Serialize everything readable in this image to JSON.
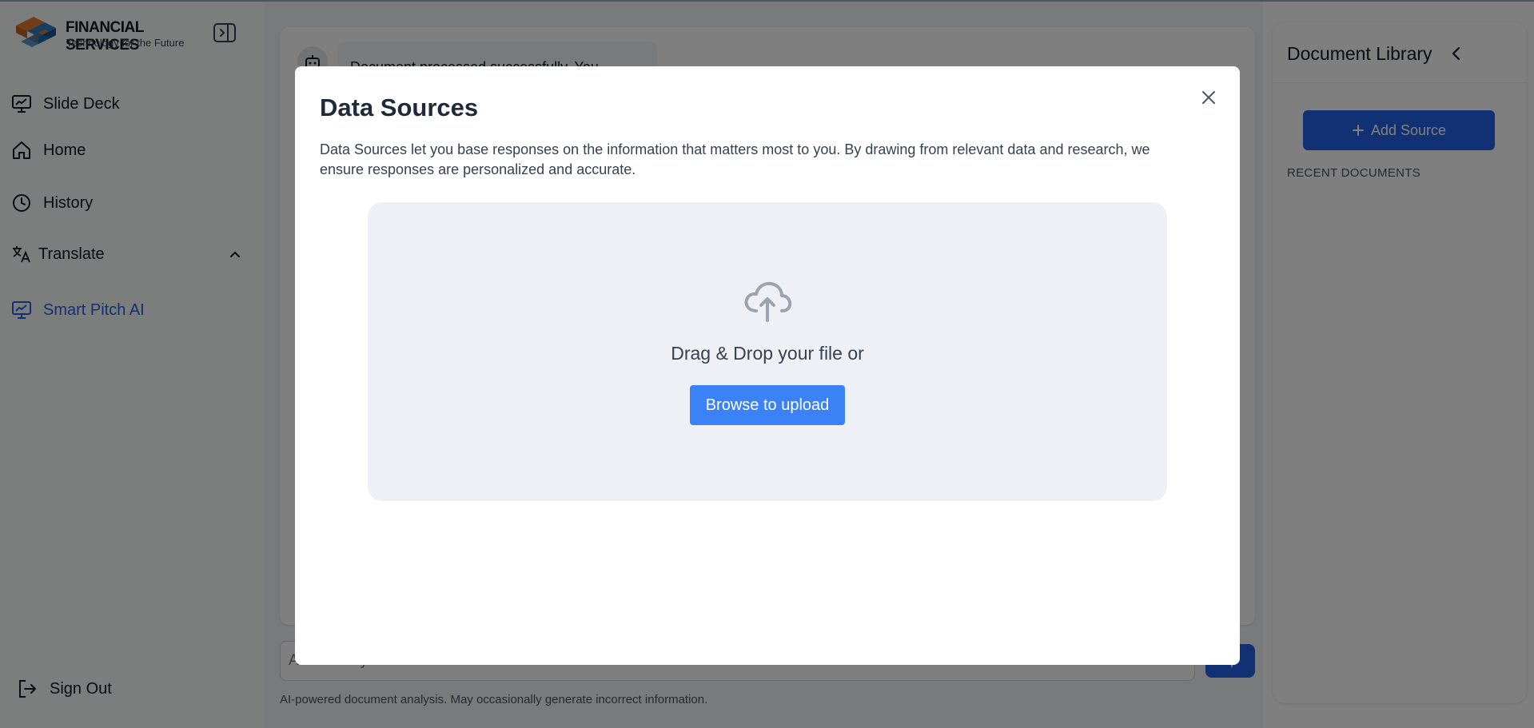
{
  "brand": {
    "title": "FINANCIAL SERVICES",
    "tagline": "Technology for the Future",
    "colors": {
      "orange": "#e07a2e",
      "blue": "#1e6fb8"
    }
  },
  "sidebar": {
    "collapse_icon": "sidebar-toggle-icon",
    "items": [
      {
        "label": "Slide Deck",
        "icon": "presentation-icon"
      },
      {
        "label": "Home",
        "icon": "home-icon"
      },
      {
        "label": "History",
        "icon": "clock-icon"
      },
      {
        "label": "Translate",
        "icon": "translate-icon",
        "expanded": true
      },
      {
        "label": "Smart Pitch AI",
        "icon": "presentation-icon",
        "active": true
      }
    ],
    "signout_label": "Sign Out"
  },
  "chat": {
    "bot_message": "Document processed successfully. You",
    "input_placeholder": "Ask about your document...",
    "disclaimer": "AI-powered document analysis. May occasionally generate incorrect information."
  },
  "library": {
    "title": "Document Library",
    "add_source_label": "Add Source",
    "recent_label": "RECENT DOCUMENTS"
  },
  "modal": {
    "title": "Data Sources",
    "description": "Data Sources let you base responses on the information that matters most to you. By drawing from relevant data and research, we ensure responses are personalized and accurate.",
    "drop_text": "Drag & Drop your file or",
    "browse_label": "Browse to upload"
  },
  "colors": {
    "accent": "#2563eb",
    "browse": "#3b82f6",
    "overlay": "rgba(0,0,0,0.5)"
  }
}
